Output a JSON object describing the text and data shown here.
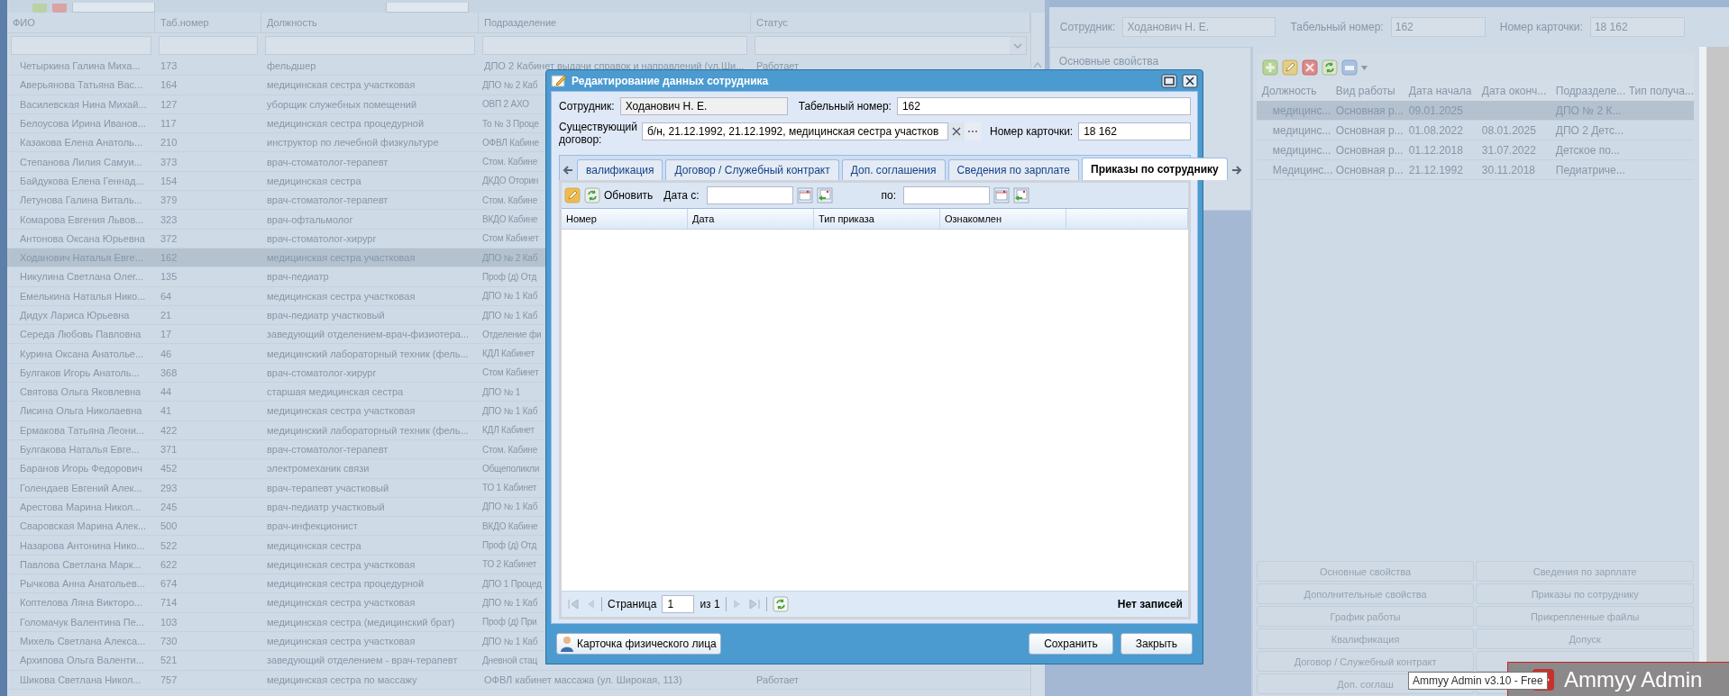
{
  "employee_list": {
    "columns": [
      "ФИО",
      "Таб.номер",
      "Должность",
      "Подразделение",
      "Статус"
    ],
    "rows": [
      {
        "name": "Четыркина Галина Миха...",
        "tab_number": "173",
        "position": "фельдшер",
        "department": "ДПО 2 Кабинет выдачи справок и направлений (ул.Ши...",
        "status": "Работает",
        "selected": false
      },
      {
        "name": "Аверьянова Татьяна Вас...",
        "tab_number": "164",
        "position": "медицинская сестра участковая",
        "department": "ДПО № 2 Каб",
        "selected": false
      },
      {
        "name": "Василевская Нина Михай...",
        "tab_number": "127",
        "position": "уборщик служебных помещений",
        "department": "ОВП 2 АХО",
        "selected": false
      },
      {
        "name": "Белоусова Ирина Иванов...",
        "tab_number": "117",
        "position": "медицинская сестра процедурной",
        "department": "То № 3 Проце",
        "selected": false
      },
      {
        "name": "Казакова Елена Анатоль...",
        "tab_number": "210",
        "position": "инструктор по лечебной физкультуре",
        "department": "ОФВЛ Кабине",
        "selected": false
      },
      {
        "name": "Степанова Лилия Самуи...",
        "tab_number": "373",
        "position": "врач-стоматолог-терапевт",
        "department": "Стом. Кабине",
        "selected": false
      },
      {
        "name": "Байдукова Елена Геннад...",
        "tab_number": "154",
        "position": "медицинская сестра",
        "department": "ДКДО Оторин",
        "selected": false
      },
      {
        "name": "Летунова Галина Виталь...",
        "tab_number": "379",
        "position": "врач-стоматолог-терапевт",
        "department": "Стом. Кабине",
        "selected": false
      },
      {
        "name": "Комарова Евгения Львов...",
        "tab_number": "323",
        "position": "врач-офтальмолог",
        "department": "ВКДО Кабине",
        "selected": false
      },
      {
        "name": "Антонова Оксана Юрьевна",
        "tab_number": "372",
        "position": "врач-стоматолог-хирург",
        "department": "Стом Кабинет",
        "selected": false
      },
      {
        "name": "Ходанович Наталья Евге...",
        "tab_number": "162",
        "position": "медицинская сестра участковая",
        "department": "ДПО № 2 Каб",
        "selected": true
      },
      {
        "name": "Никулина Светлана Олег...",
        "tab_number": "135",
        "position": "врач-педиатр",
        "department": "Проф (д) Отд",
        "selected": false
      },
      {
        "name": "Емелькина Наталья Нико...",
        "tab_number": "64",
        "position": "медицинская сестра участковая",
        "department": "ДПО № 1 Каб",
        "selected": false
      },
      {
        "name": "Дидух Лариса Юрьевна",
        "tab_number": "21",
        "position": "врач-педиатр участковый",
        "department": "ДПО № 1 Каб",
        "selected": false
      },
      {
        "name": "Середа Любовь Павловна",
        "tab_number": "17",
        "position": "заведующий отделением-врач-физиотера...",
        "department": "Отделение фи",
        "selected": false
      },
      {
        "name": "Курина Оксана Анатолье...",
        "tab_number": "46",
        "position": "медицинский лабораторный техник (фель...",
        "department": "КДЛ Кабинет",
        "selected": false
      },
      {
        "name": "Булгаков Игорь Анатоль...",
        "tab_number": "368",
        "position": "врач-стоматолог-хирург",
        "department": "Стом Кабинет",
        "selected": false
      },
      {
        "name": "Святова Ольга Яковлевна",
        "tab_number": "44",
        "position": "старшая медицинская сестра",
        "department": "ДПО № 1",
        "selected": false
      },
      {
        "name": "Лисина Ольга Николаевна",
        "tab_number": "41",
        "position": "медицинская сестра участковая",
        "department": "ДПО № 1 Каб",
        "selected": false
      },
      {
        "name": "Ермакова Татьяна Леони...",
        "tab_number": "422",
        "position": "медицинский лабораторный техник (фель...",
        "department": "КДЛ Кабинет",
        "selected": false
      },
      {
        "name": "Булгакова Наталья Евге...",
        "tab_number": "371",
        "position": "врач-стоматолог-терапевт",
        "department": "Стом. Кабине",
        "selected": false
      },
      {
        "name": "Баранов Игорь Федорович",
        "tab_number": "452",
        "position": "электромеханик связи",
        "department": "Общеполикли",
        "selected": false
      },
      {
        "name": "Голендаев Евгений Алек...",
        "tab_number": "293",
        "position": "врач-терапевт участковый",
        "department": "ТО 1 Кабинет",
        "selected": false
      },
      {
        "name": "Арестова Марина Никол...",
        "tab_number": "245",
        "position": "врач-педиатр участковый",
        "department": "ДПО № 1 Каб",
        "selected": false
      },
      {
        "name": "Сваровская Марина Алек...",
        "tab_number": "500",
        "position": "врач-инфекционист",
        "department": "ВКДО Кабине",
        "selected": false
      },
      {
        "name": "Назарова Антонина Нико...",
        "tab_number": "522",
        "position": "медицинская сестра",
        "department": "Проф (д) Отд",
        "selected": false
      },
      {
        "name": "Павлова Светлана Марк...",
        "tab_number": "622",
        "position": "медицинская сестра участковая",
        "department": "ТО 2 Кабинет",
        "selected": false
      },
      {
        "name": "Рычкова Анна Анатольев...",
        "tab_number": "674",
        "position": "медицинская сестра процедурной",
        "department": "ДПО 1 Процед",
        "selected": false
      },
      {
        "name": "Коптелова Ляна Викторо...",
        "tab_number": "714",
        "position": "медицинская сестра участковая",
        "department": "ДПО № 1 Каб",
        "selected": false
      },
      {
        "name": "Голомачук Валентина Пе...",
        "tab_number": "103",
        "position": "медицинская сестра (медицинский брат)",
        "department": "Проф (д) При",
        "selected": false
      },
      {
        "name": "Михель Светлана Алекса...",
        "tab_number": "730",
        "position": "медицинская сестра участковая",
        "department": "ДПО № 1 Каб",
        "selected": false
      },
      {
        "name": "Архипова Ольга Валенти...",
        "tab_number": "521",
        "position": "заведующий отделением - врач-терапевт",
        "department": "Дневной стац",
        "selected": false
      },
      {
        "name": "Шикова Светлана Никол...",
        "tab_number": "757",
        "position": "медицинская сестра по массажу",
        "department": "ОФВЛ кабинет массажа (ул. Широкая, 113)",
        "status": "Работает",
        "selected": false
      }
    ]
  },
  "employee_card": {
    "fields": [
      {
        "label": "Сотрудник:",
        "value": "Ходанович Н. Е."
      },
      {
        "label": "Табельный номер:",
        "value": "162"
      },
      {
        "label": "Номер карточки:",
        "value": "18 162"
      }
    ],
    "nav": [
      "Основные свойства"
    ],
    "jobs": {
      "columns": [
        "Должность",
        "Вид работы",
        "Дата начала",
        "Дата оконч...",
        "Подразделе...",
        "Тип получа..."
      ],
      "rows": [
        {
          "cells": [
            "медицинс...",
            "Основная р...",
            "09.01.2025",
            "",
            "ДПО № 2 К...",
            ""
          ],
          "selected": true
        },
        {
          "cells": [
            "медицинс...",
            "Основная р...",
            "01.08.2022",
            "08.01.2025",
            "ДПО 2 Детс...",
            ""
          ],
          "selected": false
        },
        {
          "cells": [
            "медицинс...",
            "Основная р...",
            "01.12.2018",
            "31.07.2022",
            "Детское по...",
            ""
          ],
          "selected": false
        },
        {
          "cells": [
            "Медицинс...",
            "Основная р...",
            "21.12.1992",
            "30.11.2018",
            "Педиатриче...",
            ""
          ],
          "selected": false
        }
      ]
    },
    "section_buttons": [
      [
        "Основные свойства",
        "Сведения по зарплате"
      ],
      [
        "Дополнительные свойства",
        "Приказы по сотруднику"
      ],
      [
        "График работы",
        "Прикрепленные файлы"
      ],
      [
        "Квалификация",
        "Допуск"
      ],
      [
        "Договор / Служебный контракт"
      ],
      [
        "Доп. соглаш"
      ]
    ]
  },
  "dialog": {
    "title": "Редактирование данных сотрудника",
    "employee": {
      "label": "Сотрудник:",
      "value": "Ходанович Н. Е."
    },
    "tab_number": {
      "label": "Табельный номер:",
      "value": "162"
    },
    "contract": {
      "label": "Существующий договор:",
      "value": "б/н, 21.12.1992, 21.12.1992, медицинская сестра участков"
    },
    "card_number": {
      "label": "Номер карточки:",
      "value": "18 162"
    },
    "tabs": [
      {
        "label": "валификация",
        "selected": false
      },
      {
        "label": "Договор / Служебный контракт",
        "selected": false
      },
      {
        "label": "Доп. соглашения",
        "selected": false
      },
      {
        "label": "Сведения по зарплате",
        "selected": false
      },
      {
        "label": "Приказы по сотруднику",
        "selected": true
      }
    ],
    "toolbar": {
      "refresh": "Обновить",
      "date_from": "Дата с:",
      "date_to": "по:"
    },
    "orders": {
      "columns": [
        "Номер",
        "Дата",
        "Тип приказа",
        "Ознакомлен"
      ]
    },
    "pager": {
      "page_label": "Страница",
      "page": "1",
      "of": "из 1",
      "status": "Нет записей"
    },
    "person_card_button": "Карточка физического лица",
    "buttons": [
      "Сохранить",
      "Закрыть"
    ]
  },
  "tray": {
    "tooltip": "Ammyy Admin v3.10 - Free",
    "app_title": "Ammyy Admin"
  }
}
